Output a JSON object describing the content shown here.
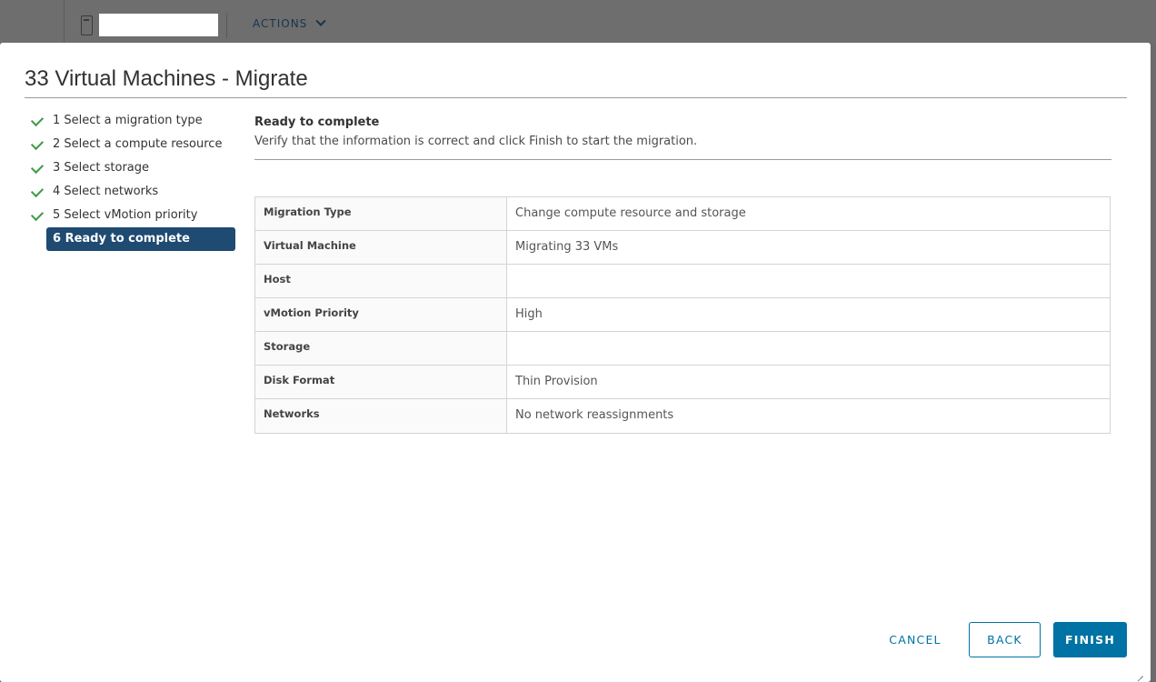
{
  "background": {
    "actions_label": "ACTIONS"
  },
  "dialog": {
    "title": "33 Virtual Machines - Migrate"
  },
  "steps": [
    {
      "label": "1 Select a migration type",
      "completed": true
    },
    {
      "label": "2 Select a compute resource",
      "completed": true
    },
    {
      "label": "3 Select storage",
      "completed": true
    },
    {
      "label": "4 Select networks",
      "completed": true
    },
    {
      "label": "5 Select vMotion priority",
      "completed": true
    },
    {
      "label": "6 Ready to complete",
      "completed": false,
      "active": true
    }
  ],
  "content": {
    "heading": "Ready to complete",
    "description": "Verify that the information is correct and click Finish to start the migration."
  },
  "summary": [
    {
      "key": "Migration Type",
      "value": "Change compute resource and storage"
    },
    {
      "key": "Virtual Machine",
      "value": "Migrating 33 VMs"
    },
    {
      "key": "Host",
      "value": ""
    },
    {
      "key": "vMotion Priority",
      "value": "High"
    },
    {
      "key": "Storage",
      "value": ""
    },
    {
      "key": "Disk Format",
      "value": "Thin Provision"
    },
    {
      "key": "Networks",
      "value": "No network reassignments"
    }
  ],
  "buttons": {
    "cancel": "CANCEL",
    "back": "BACK",
    "finish": "FINISH"
  },
  "colors": {
    "accent": "#0072a3",
    "active_step": "#1f4a72",
    "check": "#3d9b48"
  }
}
